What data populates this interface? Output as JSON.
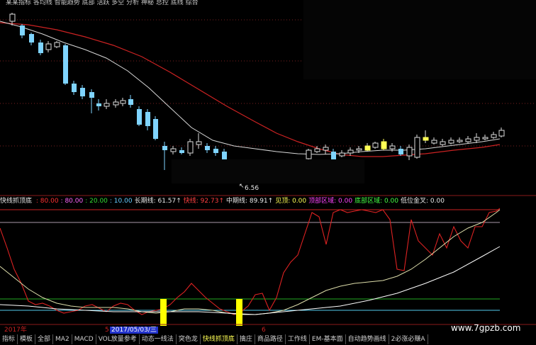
{
  "top_legend": "某某指标   各均线  智能趋势  底部    活跃   多空   分析   神秘   总控   底线   综合    ",
  "low_label": "6.56",
  "indicator": {
    "name": "快线抓顶底",
    "values": [
      {
        "text": ": 80.00",
        "color": "#ff3030"
      },
      {
        "text": ": 80.00",
        "color": "#ff66ff"
      },
      {
        "text": ": 20.00",
        "color": "#33dd33"
      },
      {
        "text": ": 10.00",
        "color": "#66ccff"
      },
      {
        "text": "长期线: 61.57↑",
        "color": "#e8e8e8"
      },
      {
        "text": "快线: 92.73↑",
        "color": "#ff4040"
      },
      {
        "text": "中期线: 89.91↑",
        "color": "#e8e8e8"
      },
      {
        "text": "见顶: 0.00",
        "color": "#ffff55"
      },
      {
        "text": "顶部区域: 0.00",
        "color": "#ff44ff"
      },
      {
        "text": "底部区域: 0.00",
        "color": "#44ff44"
      },
      {
        "text": "低位金叉: 0.00",
        "color": "#e8e8e8"
      }
    ]
  },
  "dates": {
    "year": "2017年",
    "month5": "5",
    "selected": "2017/05/03/三",
    "month6": "6"
  },
  "tabs": [
    "指标",
    "模板",
    "全部",
    "MA2",
    "MACD",
    "VOL放量参考",
    "动态一线法",
    "突色龙",
    "快线抓顶底",
    "擒庄",
    "商品路径",
    "工作线",
    "EM-基本面",
    "自动趋势画线",
    "2必涨必赚A"
  ],
  "active_tab": "快线抓顶底",
  "watermark": "www.7gpzb.com",
  "colors": {
    "up_candle": "#ffff55",
    "down_candle": "#7fd4ff",
    "ma_slow": "#cc2222",
    "ma_fast": "#d8d8d8",
    "line80": "#cc2222",
    "line20": "#22aa22",
    "line10": "#55ccee",
    "fast_line": "#dd2222",
    "mid_line": "#ddddaa",
    "long_line": "#ffffff"
  }
}
